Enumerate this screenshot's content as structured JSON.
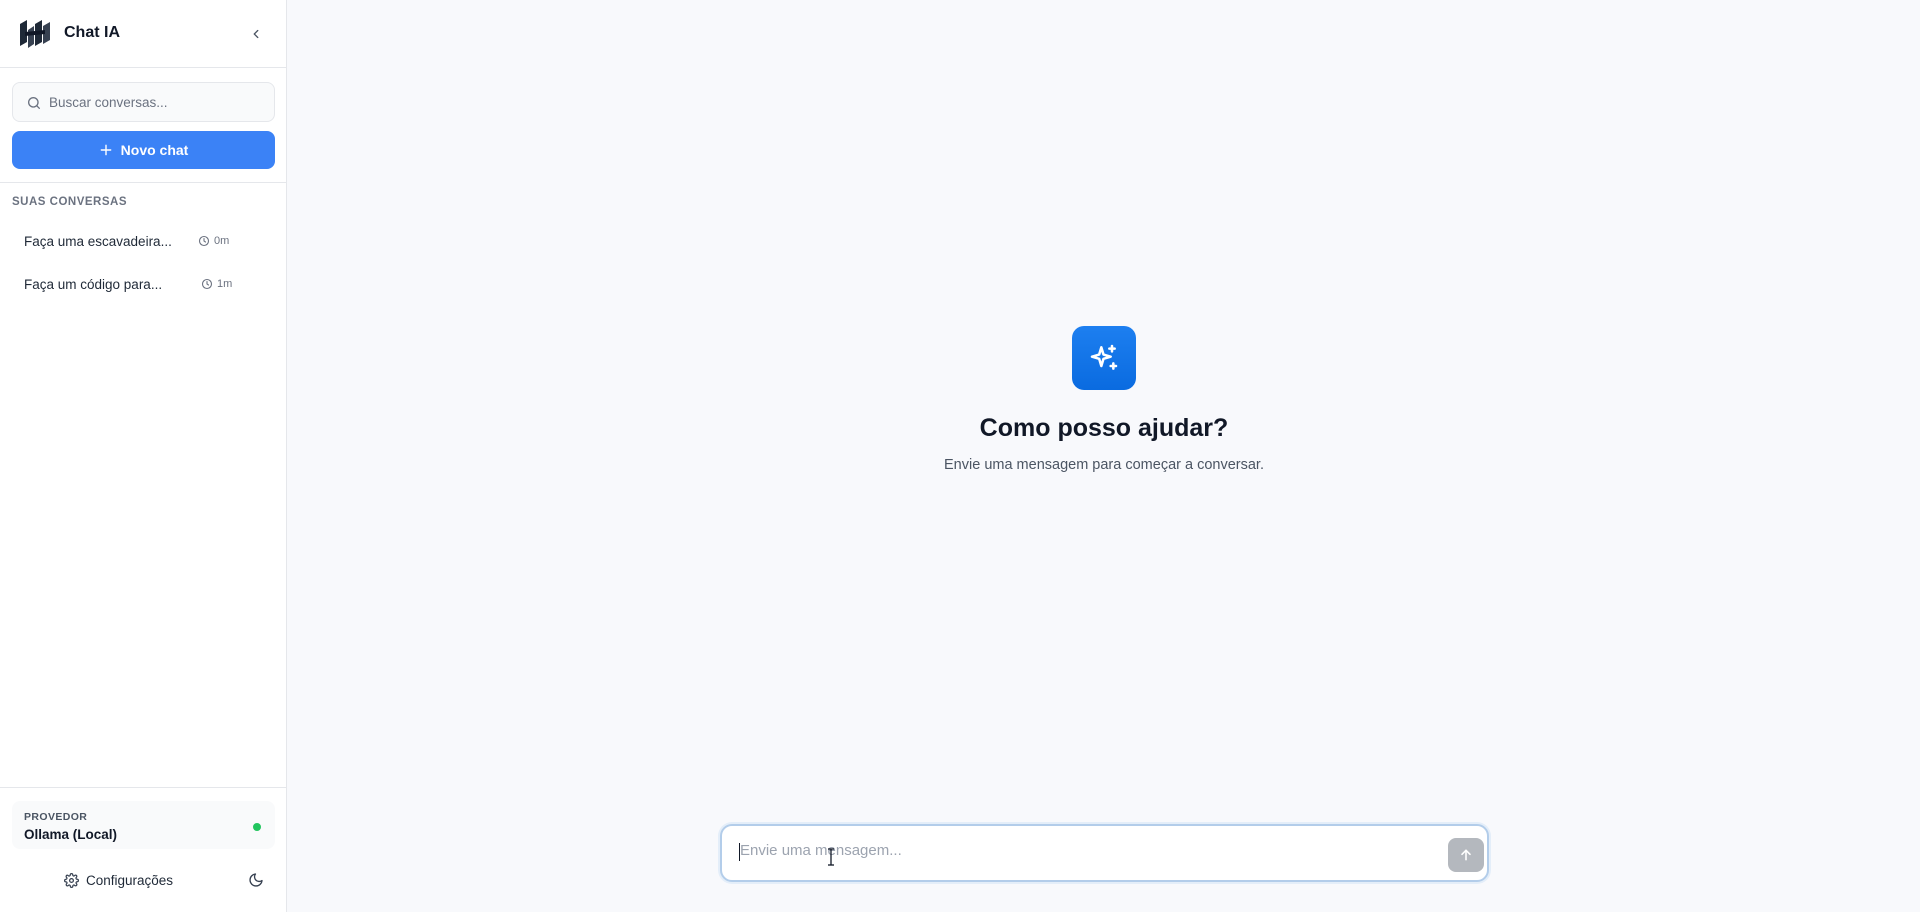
{
  "app": {
    "title": "Chat IA"
  },
  "search": {
    "placeholder": "Buscar conversas..."
  },
  "new_chat": {
    "label": "Novo chat"
  },
  "conversations": {
    "section_label": "SUAS CONVERSAS",
    "items": [
      {
        "title": "Faça uma escavadeira...",
        "time": "0m"
      },
      {
        "title": "Faça um código para...",
        "time": "1m"
      }
    ]
  },
  "provider": {
    "label": "PROVEDOR",
    "name": "Ollama (Local)",
    "status_color": "#22c55e"
  },
  "settings": {
    "label": "Configurações"
  },
  "hero": {
    "title": "Como posso ajudar?",
    "subtitle": "Envie uma mensagem para começar a conversar."
  },
  "composer": {
    "placeholder": "Envie uma mensagem...",
    "value": ""
  },
  "icons": {
    "logo": "brand-logo",
    "collapse": "chevron-left-icon",
    "search": "search-icon",
    "new_chat": "plus-icon",
    "time": "clock-icon",
    "settings": "gear-icon",
    "theme": "moon-icon",
    "hero": "sparkles-icon",
    "send": "arrow-up-icon"
  },
  "colors": {
    "accent": "#3b82f6",
    "hero_icon": "#0a6be0",
    "send_disabled": "#b4b8be"
  }
}
